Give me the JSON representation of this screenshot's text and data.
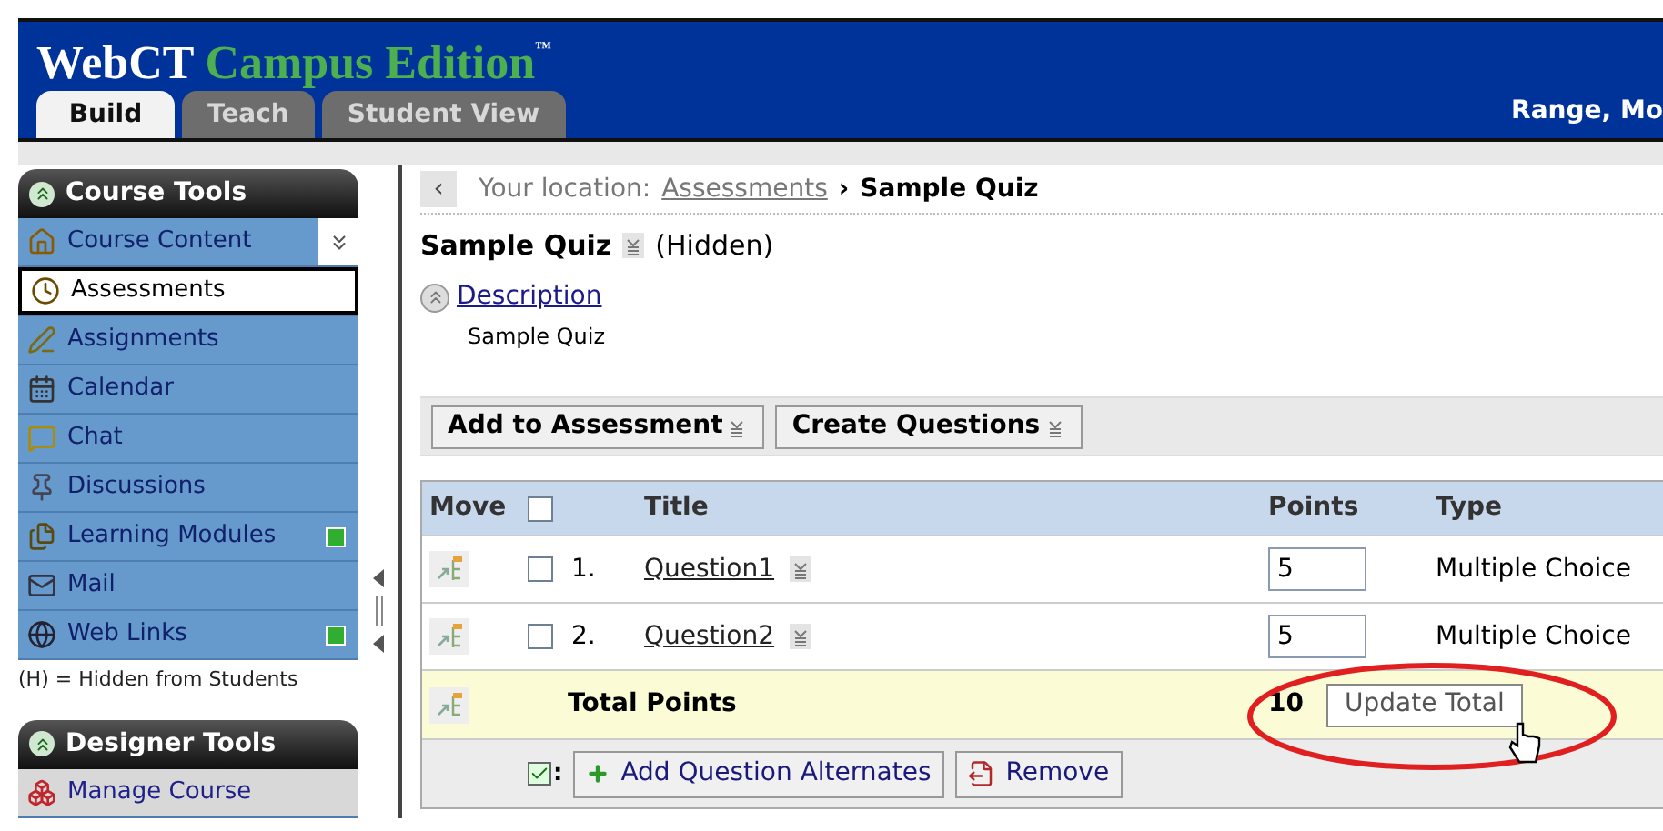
{
  "header": {
    "brand": "WebCT",
    "product": "Campus Edition",
    "trademark": "™",
    "user": "Range, Mo"
  },
  "tabs": [
    {
      "label": "Build",
      "selected": true
    },
    {
      "label": "Teach",
      "selected": false
    },
    {
      "label": "Student View",
      "selected": false
    }
  ],
  "sidebar": {
    "sections": [
      {
        "title": "Course Tools",
        "items": [
          {
            "label": "Course Content",
            "selected": false,
            "new": false,
            "collapse": true
          },
          {
            "label": "Assessments",
            "selected": true,
            "new": false,
            "collapse": false
          },
          {
            "label": "Assignments",
            "selected": false,
            "new": false,
            "collapse": false
          },
          {
            "label": "Calendar",
            "selected": false,
            "new": false,
            "collapse": false
          },
          {
            "label": "Chat",
            "selected": false,
            "new": false,
            "collapse": false
          },
          {
            "label": "Discussions",
            "selected": false,
            "new": false,
            "collapse": false
          },
          {
            "label": "Learning Modules",
            "selected": false,
            "new": true,
            "collapse": false
          },
          {
            "label": "Mail",
            "selected": false,
            "new": false,
            "collapse": false
          },
          {
            "label": "Web Links",
            "selected": false,
            "new": true,
            "collapse": false
          }
        ],
        "note": "(H) = Hidden from Students"
      },
      {
        "title": "Designer Tools",
        "items": [
          {
            "label": "Manage Course",
            "selected": false,
            "new": false,
            "collapse": false
          }
        ]
      }
    ]
  },
  "breadcrumb": {
    "back": "‹",
    "prefix": "Your location:",
    "link": "Assessments",
    "separator": "›",
    "current": "Sample Quiz"
  },
  "quiz": {
    "title": "Sample Quiz",
    "status": "(Hidden)",
    "description_link": "Description",
    "description": "Sample Quiz"
  },
  "toolbar": [
    "Add to Assessment",
    "Create Questions"
  ],
  "table": {
    "columns": [
      "Move",
      "Title",
      "Points",
      "Type"
    ],
    "header_checked": false,
    "rows": [
      {
        "number": "1.",
        "title": "Question1",
        "points": "5",
        "type": "Multiple Choice",
        "checked": false
      },
      {
        "number": "2.",
        "title": "Question2",
        "points": "5",
        "type": "Multiple Choice",
        "checked": false
      }
    ],
    "total_label": "Total Points",
    "total": "10",
    "update_button": "Update Total"
  },
  "footer": {
    "separator": ":",
    "buttons": [
      {
        "label": "Add Question Alternates",
        "kind": "add"
      },
      {
        "label": "Remove",
        "kind": "remove"
      }
    ]
  }
}
